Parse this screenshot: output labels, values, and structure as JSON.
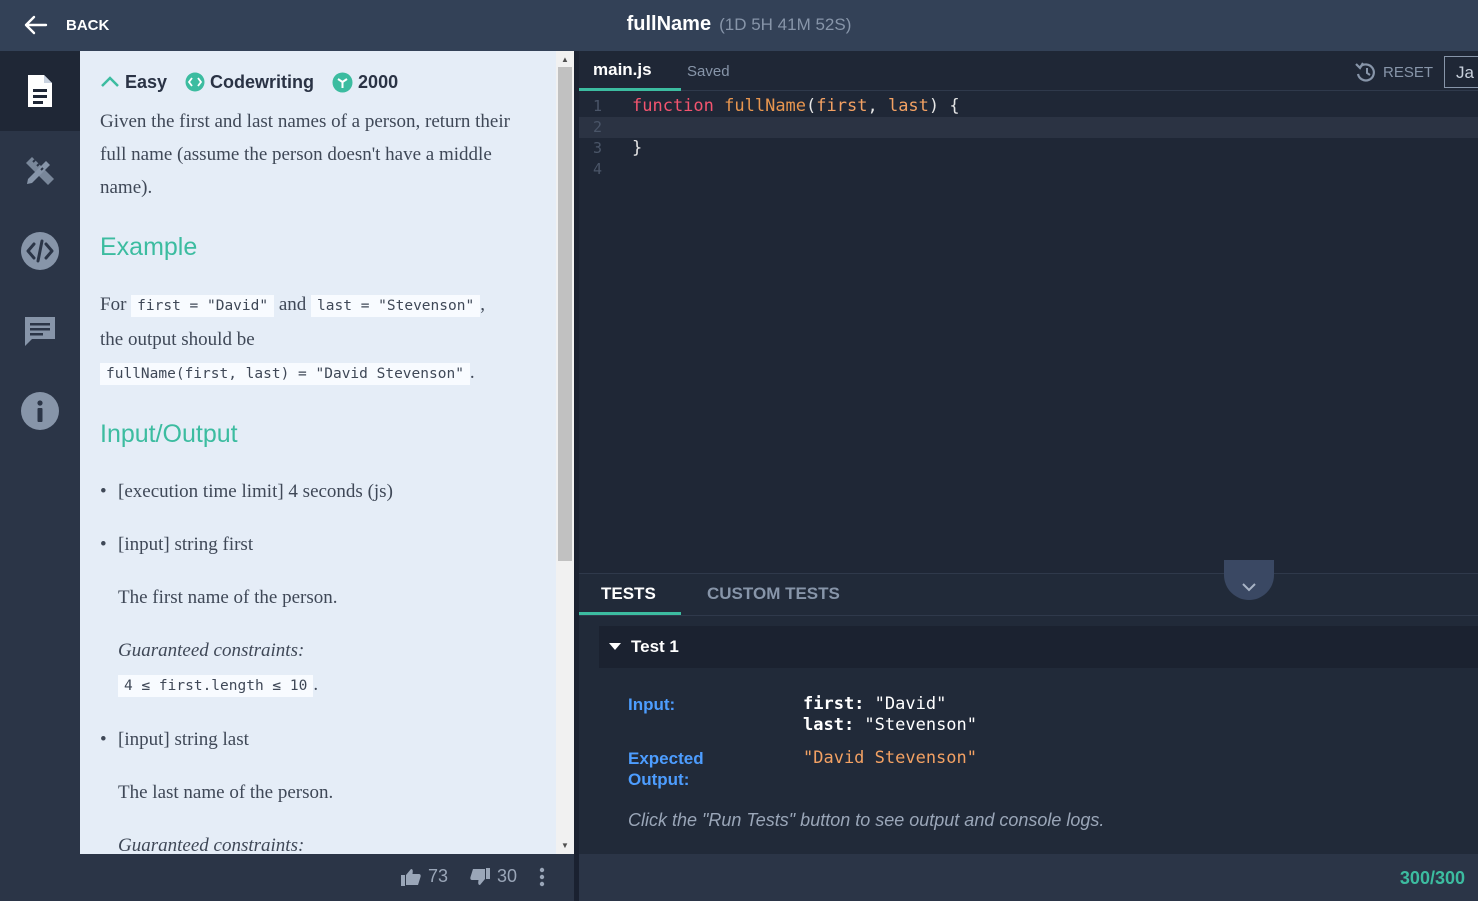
{
  "header": {
    "back_label": "BACK",
    "title": "fullName",
    "timer": "(1D 5H 41M 52S)"
  },
  "sidebar": {
    "items": [
      {
        "icon": "document-icon",
        "active": true
      },
      {
        "icon": "pencil-ruler-icon",
        "active": false
      },
      {
        "icon": "code-icon",
        "active": false
      },
      {
        "icon": "chat-icon",
        "active": false
      },
      {
        "icon": "info-icon",
        "active": false
      }
    ]
  },
  "task": {
    "difficulty": "Easy",
    "category": "Codewriting",
    "points": "2000",
    "description": "Given the first and last names of a person, return their full name (assume the person doesn't have a middle name).",
    "example_heading": "Example",
    "example": {
      "for": "For",
      "code1": "first = \"David\"",
      "and": "and",
      "code2": "last = \"Stevenson\"",
      "comma": ",",
      "output_text": "the output should be",
      "code3": "fullName(first, last) = \"David Stevenson\"",
      "period": "."
    },
    "io_heading": "Input/Output",
    "io": {
      "exec_limit": "[execution time limit] 4 seconds (js)",
      "input1": "[input] string first",
      "input1_desc": "The first name of the person.",
      "gc_label": "Guaranteed constraints:",
      "input1_constraint": "4 ≤ first.length ≤ 10",
      "period": ".",
      "input2": "[input] string last",
      "input2_desc": "The last name of the person.",
      "gc_label2": "Guaranteed constraints:"
    }
  },
  "votes": {
    "up": "73",
    "down": "30"
  },
  "editor": {
    "file_tab": "main.js",
    "status": "Saved",
    "reset_label": "RESET",
    "language": "Ja",
    "line_numbers": [
      "1",
      "2",
      "3",
      "4"
    ],
    "code": {
      "kw": "function",
      "fn": "fullName",
      "open": "(",
      "p1": "first",
      "comma": ", ",
      "p2": "last",
      "close": ") {",
      "brace": "}"
    }
  },
  "tests": {
    "tab_tests": "TESTS",
    "tab_custom": "CUSTOM TESTS",
    "test1_label": "Test 1",
    "input_label": "Input:",
    "input_line1_key": "first:",
    "input_line1_val": " \"David\"",
    "input_line2_key": "last:",
    "input_line2_val": " \"Stevenson\"",
    "expected_label_1": "Expected",
    "expected_label_2": "Output:",
    "expected_value": "\"David Stevenson\"",
    "hint": "Click the \"Run Tests\" button to see output and console logs."
  },
  "score": "300/300"
}
